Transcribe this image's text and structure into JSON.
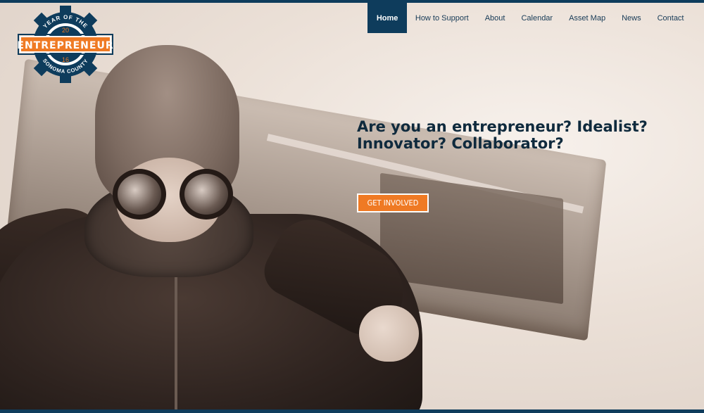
{
  "logo": {
    "arc_top": "YEAR OF THE",
    "year_top": "20",
    "banner": "ENTREPRENEUR",
    "year_bottom": "16",
    "arc_bottom": "SONOMA COUNTY",
    "colors": {
      "navy": "#0e3c5c",
      "orange": "#ef7a24",
      "white": "#ffffff"
    }
  },
  "nav": {
    "items": [
      {
        "label": "Home",
        "active": true
      },
      {
        "label": "How to Support",
        "active": false
      },
      {
        "label": "About",
        "active": false
      },
      {
        "label": "Calendar",
        "active": false
      },
      {
        "label": "Asset Map",
        "active": false
      },
      {
        "label": "News",
        "active": false
      },
      {
        "label": "Contact",
        "active": false
      }
    ]
  },
  "hero": {
    "headline": "Are you an entrepreneur? Idealist? Innovator? Collaborator?",
    "cta_label": "GET INVOLVED"
  },
  "colors": {
    "accent": "#ef7a24",
    "brand": "#0e3c5c",
    "headline": "#0f2a3d"
  }
}
